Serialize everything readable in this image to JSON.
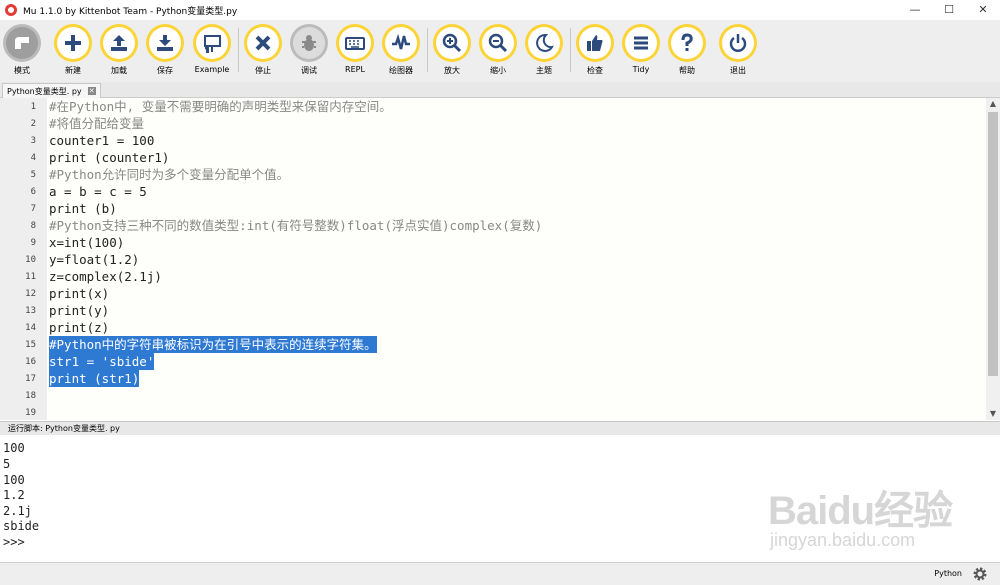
{
  "window": {
    "title": "Mu 1.1.0 by Kittenbot Team - Python变量类型.py",
    "controls": [
      "—",
      "☐",
      "✕"
    ]
  },
  "toolbar": {
    "buttons": [
      {
        "label": "模式",
        "icon": "mode-icon"
      },
      {
        "label": "新建",
        "icon": "plus-icon"
      },
      {
        "label": "加载",
        "icon": "upload-icon"
      },
      {
        "label": "保存",
        "icon": "download-icon"
      },
      {
        "label": "Example",
        "icon": "presentation-icon"
      },
      {
        "label": "停止",
        "icon": "stop-x-icon"
      },
      {
        "label": "调试",
        "icon": "bug-icon"
      },
      {
        "label": "REPL",
        "icon": "keyboard-icon"
      },
      {
        "label": "绘图器",
        "icon": "plotter-wave-icon"
      },
      {
        "label": "放大",
        "icon": "zoom-in-icon"
      },
      {
        "label": "缩小",
        "icon": "zoom-out-icon"
      },
      {
        "label": "主题",
        "icon": "moon-icon"
      },
      {
        "label": "检查",
        "icon": "thumbs-up-icon"
      },
      {
        "label": "Tidy",
        "icon": "lines-icon"
      },
      {
        "label": "帮助",
        "icon": "question-icon"
      },
      {
        "label": "退出",
        "icon": "power-icon"
      }
    ]
  },
  "tab": {
    "label": "Python变量类型. py",
    "close": "✕"
  },
  "editor": {
    "line_numbers": [
      "1",
      "2",
      "3",
      "4",
      "5",
      "6",
      "7",
      "8",
      "9",
      "10",
      "11",
      "12",
      "13",
      "14",
      "15",
      "16",
      "17",
      "18",
      "19"
    ],
    "lines": [
      "#在Python中, 变量不需要明确的声明类型来保留内存空间。",
      "#将值分配给变量",
      "counter1 = 100",
      "print (counter1)",
      "#Python允许同时为多个变量分配单个值。",
      "a = b = c = 5",
      "print (b)",
      "#Python支持三种不同的数值类型:int(有符号整数)float(浮点实值)complex(复数)",
      "x=int(100)",
      "y=float(1.2)",
      "z=complex(2.1j)",
      "print(x)",
      "print(y)",
      "print(z)",
      "#Python中的字符串被标识为在引号中表示的连续字符集。",
      "str1 = 'sbide'",
      "print (str1)",
      "",
      ""
    ],
    "selected_lines": [
      15,
      16,
      17
    ]
  },
  "run_panel": {
    "header": "运行脚本: Python变量类型. py",
    "output": [
      "100",
      "5",
      "100",
      "1.2",
      "2.1j",
      "sbide",
      ">>>"
    ]
  },
  "statusbar": {
    "mode": "Python",
    "settings_icon": "gear-icon"
  },
  "watermark": {
    "logo": "Baidu经验",
    "url": "jingyan.baidu.com"
  },
  "colors": {
    "toolbar_accent": "#fcd435",
    "selection": "#2e7ad3",
    "editor_bg": "#fefefa"
  }
}
